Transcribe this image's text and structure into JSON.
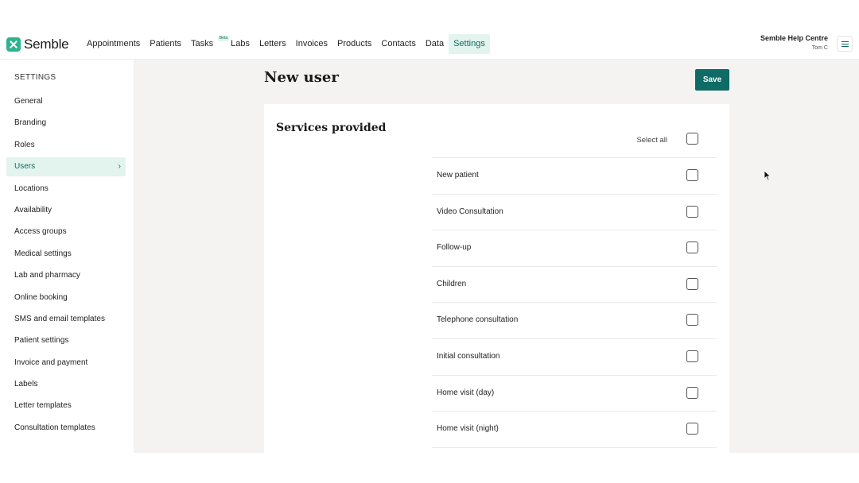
{
  "app": {
    "logo_text": "Semble"
  },
  "nav": {
    "items": [
      {
        "label": "Appointments"
      },
      {
        "label": "Patients"
      },
      {
        "label": "Tasks",
        "badge": "Beta"
      },
      {
        "label": "Labs"
      },
      {
        "label": "Letters"
      },
      {
        "label": "Invoices"
      },
      {
        "label": "Products"
      },
      {
        "label": "Contacts"
      },
      {
        "label": "Data"
      },
      {
        "label": "Settings",
        "active": true
      }
    ]
  },
  "header_right": {
    "help_title": "Semble Help Centre",
    "user": "Tom C"
  },
  "sidebar": {
    "title": "SETTINGS",
    "items": [
      {
        "label": "General"
      },
      {
        "label": "Branding"
      },
      {
        "label": "Roles"
      },
      {
        "label": "Users",
        "active": true
      },
      {
        "label": "Locations"
      },
      {
        "label": "Availability"
      },
      {
        "label": "Access groups"
      },
      {
        "label": "Medical settings"
      },
      {
        "label": "Lab and pharmacy"
      },
      {
        "label": "Online booking"
      },
      {
        "label": "SMS and email templates"
      },
      {
        "label": "Patient settings"
      },
      {
        "label": "Invoice and payment"
      },
      {
        "label": "Labels"
      },
      {
        "label": "Letter templates"
      },
      {
        "label": "Consultation templates"
      }
    ]
  },
  "main": {
    "title": "New user",
    "save_label": "Save",
    "services": {
      "title": "Services provided",
      "select_all_label": "Select all",
      "items": [
        {
          "label": "New patient",
          "checked": false
        },
        {
          "label": "Video Consultation",
          "checked": false
        },
        {
          "label": "Follow-up",
          "checked": false
        },
        {
          "label": "Children",
          "checked": false
        },
        {
          "label": "Telephone consultation",
          "checked": false
        },
        {
          "label": "Initial consultation",
          "checked": false
        },
        {
          "label": "Home visit (day)",
          "checked": false
        },
        {
          "label": "Home visit (night)",
          "checked": false
        }
      ]
    }
  },
  "colors": {
    "accent": "#0f6b65",
    "brand": "#2bb58e",
    "active_bg": "#e3f4ee",
    "content_bg": "#f4f3f1"
  }
}
